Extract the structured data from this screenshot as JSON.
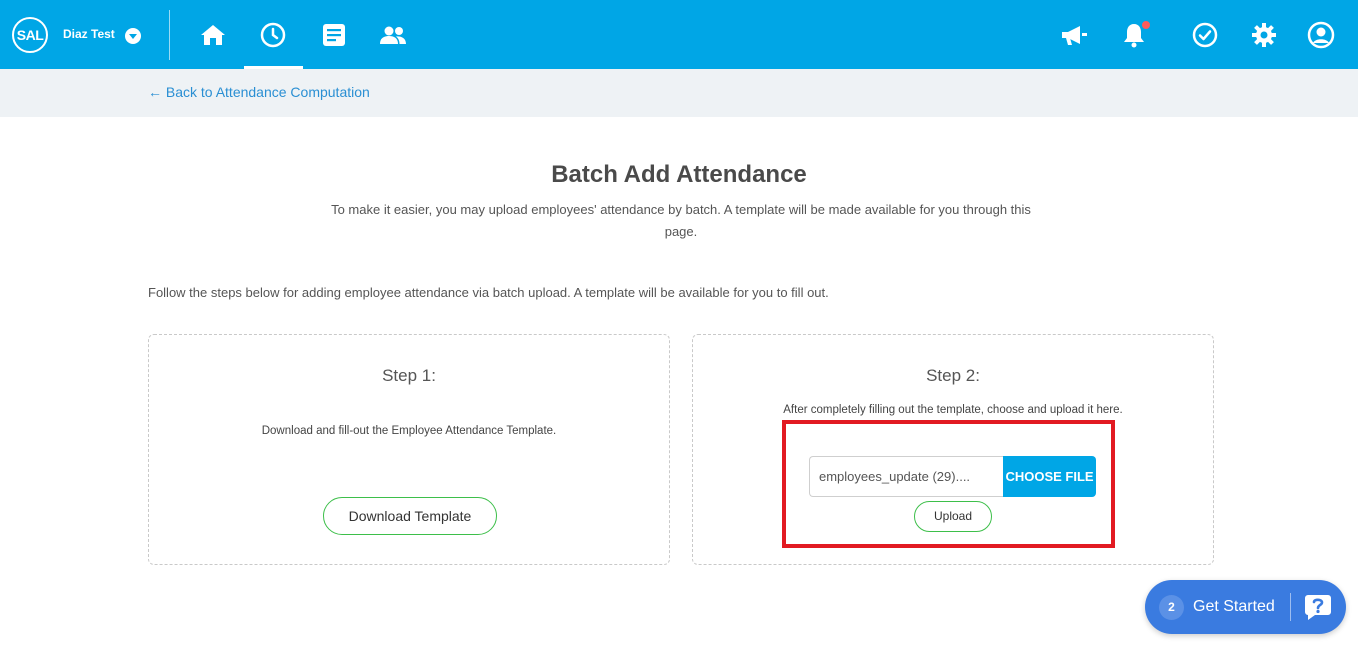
{
  "header": {
    "logo_text": "SAL",
    "company_name": "Diaz Test",
    "nav": [
      {
        "name": "home",
        "icon": "home-icon"
      },
      {
        "name": "attendance",
        "icon": "clock-icon",
        "active": true
      },
      {
        "name": "reports",
        "icon": "document-icon"
      },
      {
        "name": "employees",
        "icon": "people-icon"
      }
    ],
    "right_icons": [
      "megaphone-icon",
      "bell-icon",
      "check-circle-icon",
      "gear-icon",
      "user-icon"
    ],
    "accent_color": "#00a6e6"
  },
  "breadcrumb": {
    "back_label": "← Back to Attendance Computation"
  },
  "page": {
    "title": "Batch Add Attendance",
    "subtitle": "To make it easier, you may upload employees' attendance by batch. A template will be made available for you through this page.",
    "instructions": "Follow the steps below for adding employee attendance via batch upload. A template will be available for you to fill out."
  },
  "step1": {
    "title": "Step 1:",
    "description": "Download and fill-out the Employee Attendance Template.",
    "button_label": "Download Template"
  },
  "step2": {
    "title": "Step 2:",
    "description": "After completely filling out the template, choose and upload it here.",
    "file_value": "employees_update (29)....",
    "choose_label": "CHOOSE FILE",
    "upload_label": "Upload"
  },
  "widget": {
    "count": "2",
    "label": "Get Started"
  }
}
